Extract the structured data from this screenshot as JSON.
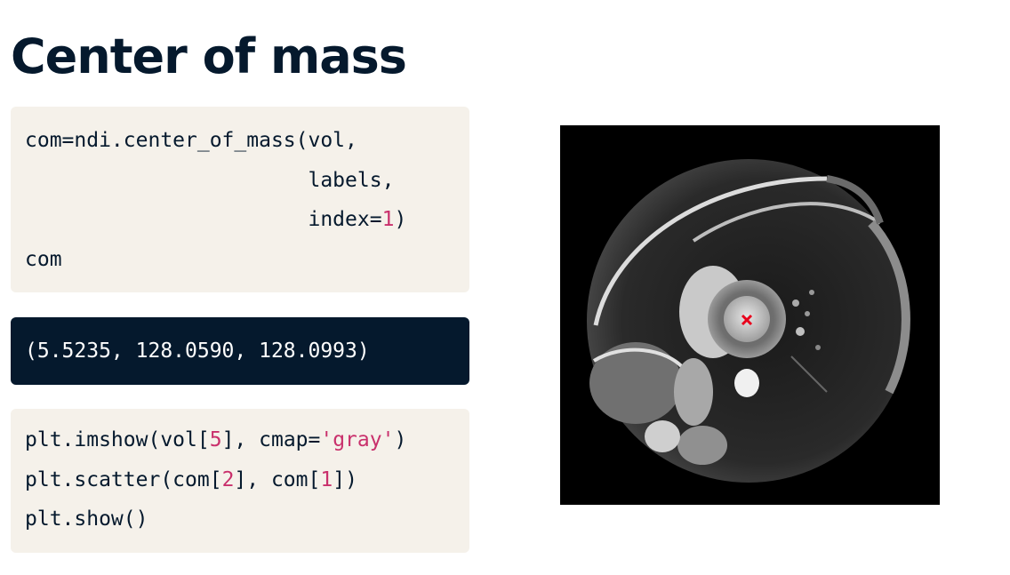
{
  "slide": {
    "title": "Center of mass"
  },
  "code_block_1": {
    "lines": [
      [
        {
          "t": "com=ndi.center_of_mass(vol,",
          "c": "plain"
        }
      ],
      [
        {
          "t": "                       labels,",
          "c": "plain"
        }
      ],
      [
        {
          "t": "                       index=",
          "c": "plain"
        },
        {
          "t": "1",
          "c": "num"
        },
        {
          "t": ")",
          "c": "plain"
        }
      ],
      [
        {
          "t": "com",
          "c": "plain"
        }
      ]
    ]
  },
  "output": {
    "text": "(5.5235, 128.0590, 128.0993)"
  },
  "code_block_2": {
    "lines": [
      [
        {
          "t": "plt.imshow(vol[",
          "c": "plain"
        },
        {
          "t": "5",
          "c": "num"
        },
        {
          "t": "], cmap=",
          "c": "plain"
        },
        {
          "t": "'gray'",
          "c": "str"
        },
        {
          "t": ")",
          "c": "plain"
        }
      ],
      [
        {
          "t": "plt.scatter(com[",
          "c": "plain"
        },
        {
          "t": "2",
          "c": "num"
        },
        {
          "t": "], com[",
          "c": "plain"
        },
        {
          "t": "1",
          "c": "num"
        },
        {
          "t": "])",
          "c": "plain"
        }
      ],
      [
        {
          "t": "plt.show()",
          "c": "plain"
        }
      ]
    ]
  },
  "image": {
    "content": "cardiac MRI short-axis slice, grayscale",
    "marker": {
      "symbol": "x",
      "color": "#e8001c"
    }
  },
  "colors": {
    "title": "#05192d",
    "code_bg": "#f5f1ea",
    "output_bg": "#05192d",
    "syntax_number": "#c9306c",
    "marker": "#e8001c"
  }
}
